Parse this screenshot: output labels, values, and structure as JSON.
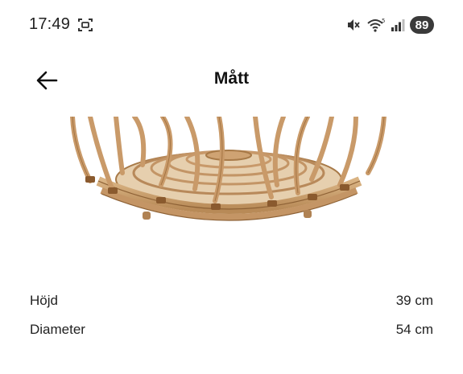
{
  "status_bar": {
    "time": "17:49",
    "battery_level": "89",
    "icons": [
      "screenshot-icon",
      "mute-icon",
      "wifi-icon",
      "signal-icon",
      "battery-icon"
    ]
  },
  "header": {
    "title": "Mått",
    "back_icon": "arrow-left-icon"
  },
  "product_image": {
    "subject": "rattan basket base"
  },
  "measurements": [
    {
      "label": "Höjd",
      "value": "39 cm"
    },
    {
      "label": "Diameter",
      "value": "54 cm"
    }
  ]
}
